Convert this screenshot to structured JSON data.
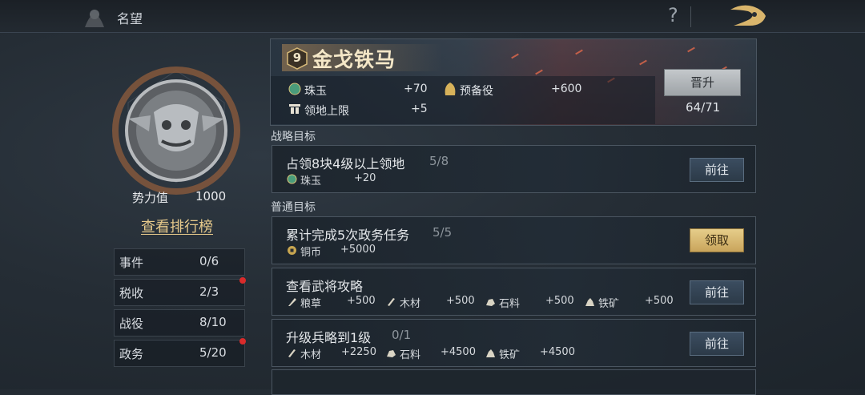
{
  "topbar": {
    "title": "名望",
    "help_glyph": "?"
  },
  "profile": {
    "power_label": "势力值",
    "power_value": "1000",
    "ranking_link": "查看排行榜",
    "stats": [
      {
        "label": "事件",
        "value": "0/6",
        "dot": false
      },
      {
        "label": "税收",
        "value": "2/3",
        "dot": true
      },
      {
        "label": "战役",
        "value": "8/10",
        "dot": false
      },
      {
        "label": "政务",
        "value": "5/20",
        "dot": true
      }
    ]
  },
  "banner": {
    "level": "9",
    "title": "金戈铁马",
    "rewards": [
      {
        "icon": "jade-icon",
        "label": "珠玉",
        "value": "+70"
      },
      {
        "icon": "reserve-troops-icon",
        "label": "预备役",
        "value": "+600"
      },
      {
        "icon": "territory-cap-icon",
        "label": "领地上限",
        "value": "+5"
      }
    ],
    "promote_label": "晋升",
    "progress": "64/71"
  },
  "sections": {
    "strategic": "战略目标",
    "normal": "普通目标"
  },
  "tasks": [
    {
      "title": "占领8块4级以上领地",
      "progress": "5/8",
      "button": "前往",
      "claim": false,
      "rewards": [
        {
          "icon": "jade-icon",
          "label": "珠玉",
          "value": "+20"
        }
      ]
    },
    {
      "title": "累计完成5次政务任务",
      "progress": "5/5",
      "button": "领取",
      "claim": true,
      "rewards": [
        {
          "icon": "copper-coin-icon",
          "label": "铜币",
          "value": "+5000"
        }
      ]
    },
    {
      "title": "查看武将攻略",
      "progress": "",
      "button": "前往",
      "claim": false,
      "rewards": [
        {
          "icon": "grain-icon",
          "label": "粮草",
          "value": "+500"
        },
        {
          "icon": "wood-icon",
          "label": "木材",
          "value": "+500"
        },
        {
          "icon": "stone-icon",
          "label": "石料",
          "value": "+500"
        },
        {
          "icon": "iron-ore-icon",
          "label": "铁矿",
          "value": "+500"
        }
      ]
    },
    {
      "title": "升级兵略到1级",
      "progress": "0/1",
      "button": "前往",
      "claim": false,
      "rewards": [
        {
          "icon": "wood-icon",
          "label": "木材",
          "value": "+2250"
        },
        {
          "icon": "stone-icon",
          "label": "石料",
          "value": "+4500"
        },
        {
          "icon": "iron-ore-icon",
          "label": "铁矿",
          "value": "+4500"
        }
      ]
    }
  ]
}
